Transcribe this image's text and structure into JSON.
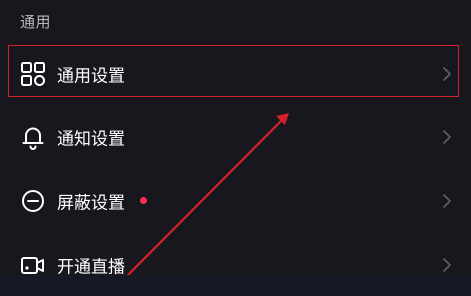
{
  "section": {
    "title": "通用"
  },
  "items": [
    {
      "label": "通用设置",
      "icon": "grid-settings-icon"
    },
    {
      "label": "通知设置",
      "icon": "bell-icon"
    },
    {
      "label": "屏蔽设置",
      "icon": "minus-circle-icon",
      "dot": true
    },
    {
      "label": "开通直播",
      "icon": "video-camera-icon"
    }
  ],
  "colors": {
    "background": "#18171d",
    "annotation_red": "#d3222c",
    "notification_dot": "#fe2c55",
    "chevron": "#5e5d63"
  }
}
